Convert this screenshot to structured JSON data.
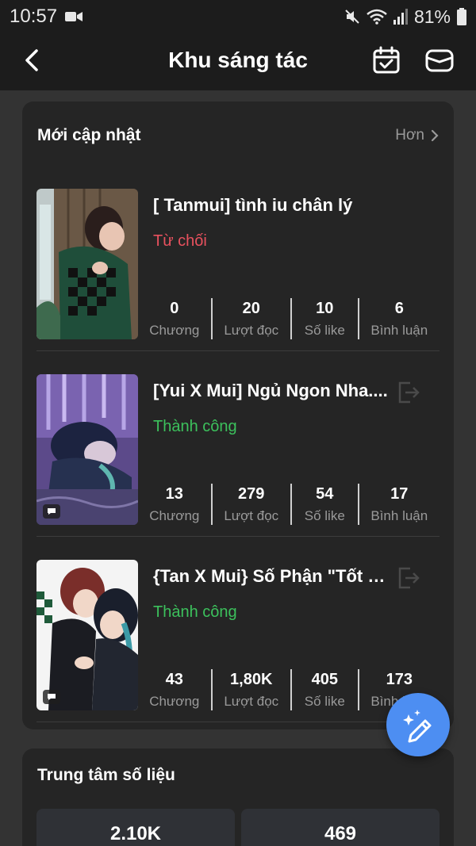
{
  "status_bar": {
    "time": "10:57",
    "battery": "81%"
  },
  "app_bar": {
    "title": "Khu sáng tác"
  },
  "recent": {
    "title": "Mới cập nhật",
    "more_label": "Hơn",
    "stories": [
      {
        "title": "[ Tanmui] tình iu chân lý",
        "status": "Từ chối",
        "stats": [
          {
            "value": "0",
            "label": "Chương"
          },
          {
            "value": "20",
            "label": "Lượt đọc"
          },
          {
            "value": "10",
            "label": "Số like"
          },
          {
            "value": "6",
            "label": "Bình luận"
          }
        ]
      },
      {
        "title": "[Yui X Mui] Ngủ Ngon Nha....",
        "status": "Thành công",
        "stats": [
          {
            "value": "13",
            "label": "Chương"
          },
          {
            "value": "279",
            "label": "Lượt đọc"
          },
          {
            "value": "54",
            "label": "Số like"
          },
          {
            "value": "17",
            "label": "Bình luận"
          }
        ]
      },
      {
        "title": "{Tan X Mui} Số Phận \"Tốt X...",
        "status": "Thành công",
        "stats": [
          {
            "value": "43",
            "label": "Chương"
          },
          {
            "value": "1,80K",
            "label": "Lượt đọc"
          },
          {
            "value": "405",
            "label": "Số like"
          },
          {
            "value": "173",
            "label": "Bình luận"
          }
        ]
      }
    ]
  },
  "data_center": {
    "title": "Trung tâm số liệu",
    "metrics": [
      "2.10K",
      "469"
    ]
  },
  "colors": {
    "rejected": "#e8515e",
    "success": "#3cc15c",
    "fab": "#4d8ef2"
  },
  "icons": {
    "back": "chevron-left-icon",
    "calendar": "calendar-check-icon",
    "mail": "mail-icon",
    "exit": "exit-icon",
    "fab": "magic-pen-icon"
  }
}
